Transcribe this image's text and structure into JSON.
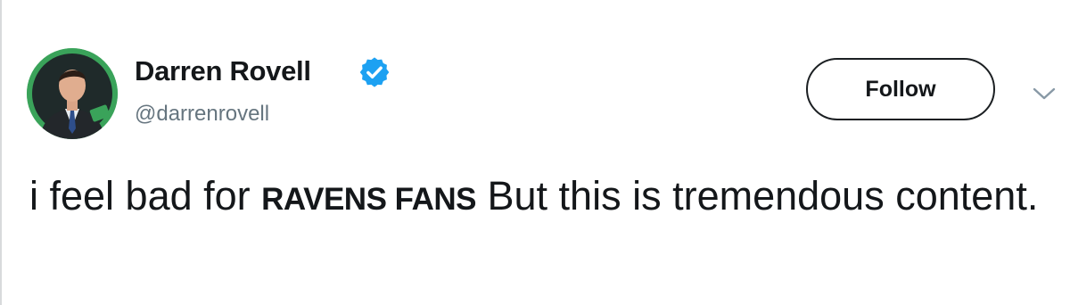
{
  "tweet": {
    "author": {
      "display_name": "Darren Rovell",
      "username": "@darrenrovell",
      "verified": true,
      "avatar_icon": "profile-photo",
      "avatar_bg": "#3aa35a"
    },
    "follow_label": "Follow",
    "menu_icon": "chevron-down-icon",
    "text_part1": "i feel bad for ",
    "text_emphasis": "RAVENS FANS",
    "text_part2": " But this is tremendous content."
  },
  "colors": {
    "verified": "#1da1f2",
    "text_primary": "#14171a",
    "text_secondary": "#66757f"
  }
}
